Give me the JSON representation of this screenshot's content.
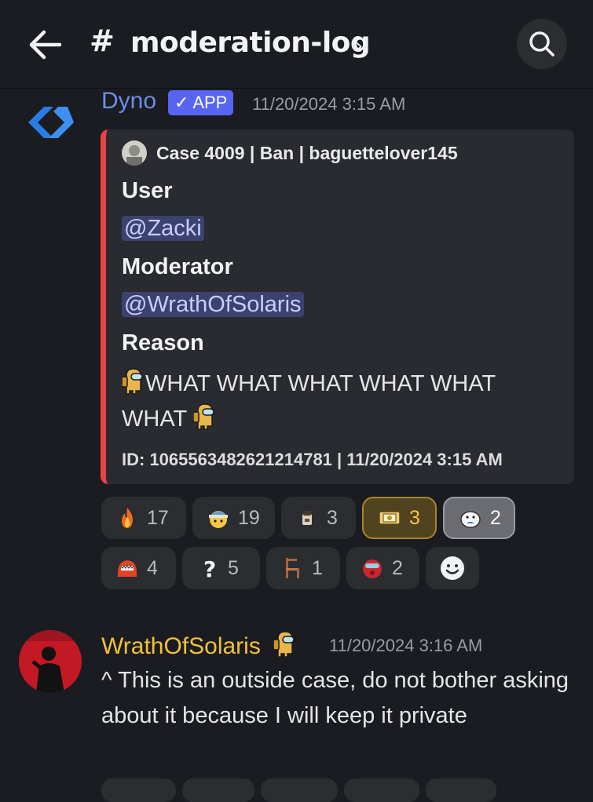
{
  "header": {
    "hash": "#",
    "channel_name": "moderation-log",
    "chevron": "›"
  },
  "messages": [
    {
      "author": "Dyno",
      "badge": "✓ APP",
      "timestamp": "11/20/2024 3:15 AM",
      "embed": {
        "accent_color": "#ec4245",
        "author_line": "Case 4009 | Ban | baguettelover145",
        "fields": [
          {
            "name": "User",
            "value": "@Zacki"
          },
          {
            "name": "Moderator",
            "value": "@WrathOfSolaris"
          },
          {
            "name": "Reason",
            "value": "WHAT WHAT WHAT WHAT WHAT WHAT"
          }
        ],
        "footer": "ID: 1065563482621214781 | 11/20/2024 3:15 AM"
      },
      "reactions": [
        {
          "icon": "fire-icon",
          "count": "17"
        },
        {
          "icon": "beanie-face-icon",
          "count": "19"
        },
        {
          "icon": "small-figure-icon",
          "count": "3"
        },
        {
          "icon": "ticket-emoji-icon",
          "count": "3",
          "active": "gold"
        },
        {
          "icon": "sticker-emoji-icon",
          "count": "2",
          "active": "silver"
        },
        {
          "icon": "red-creature-icon",
          "count": "4"
        },
        {
          "icon": "question-mark-icon",
          "count": "5"
        },
        {
          "icon": "chair-icon",
          "count": "1"
        },
        {
          "icon": "red-helmet-icon",
          "count": "2"
        }
      ]
    },
    {
      "author": "WrathOfSolaris",
      "timestamp": "11/20/2024 3:16 AM",
      "text": "^ This is an outside case, do not bother asking about it because I will keep it private"
    }
  ],
  "colors": {
    "background": "#1b1c21",
    "dyno_name": "#6b8ee8",
    "app_badge": "#5865f2",
    "mention_bg": "#3c4270",
    "wrath_name": "#f0c23b"
  }
}
